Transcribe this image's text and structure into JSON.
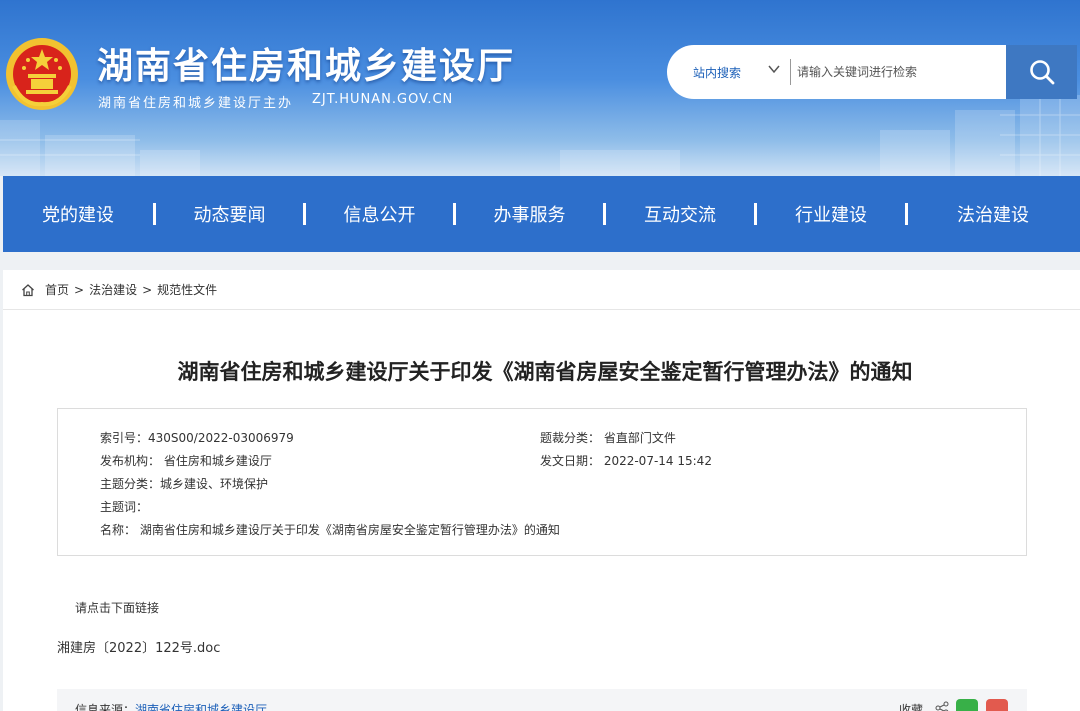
{
  "header": {
    "site_title": "湖南省住房和城乡建设厅",
    "host": "湖南省住房和城乡建设厅主办",
    "url": "ZJT.HUNAN.GOV.CN"
  },
  "search": {
    "scope": "站内搜索",
    "placeholder": "请输入关键词进行检索"
  },
  "nav": [
    "党的建设",
    "动态要闻",
    "信息公开",
    "办事服务",
    "互动交流",
    "行业建设",
    "法治建设"
  ],
  "breadcrumb": [
    "首页",
    "法治建设",
    "规范性文件"
  ],
  "article": {
    "title": "湖南省住房和城乡建设厅关于印发《湖南省房屋安全鉴定暂行管理办法》的通知",
    "meta": {
      "index_no": "索引号：430S00/2022-03006979",
      "category": "题裁分类： 省直部门文件",
      "publisher": "发布机构： 省住房和城乡建设厅",
      "date": "发文日期： 2022-07-14 15:42",
      "topic_class": "主题分类：城乡建设、环境保护",
      "keywords": "主题词：",
      "name": "名称： 湖南省住房和城乡建设厅关于印发《湖南省房屋安全鉴定暂行管理办法》的通知"
    },
    "intro": "请点击下面链接",
    "attachment": "湘建房〔2022〕122号.doc"
  },
  "footer": {
    "source_label": "信息来源：",
    "source_value": "湖南省住房和城乡建设厅",
    "favorite": "收藏"
  },
  "colors": {
    "header_blue": "#2f74cf",
    "nav_blue": "#2d6fcb",
    "link_blue": "#1b5fb8"
  }
}
